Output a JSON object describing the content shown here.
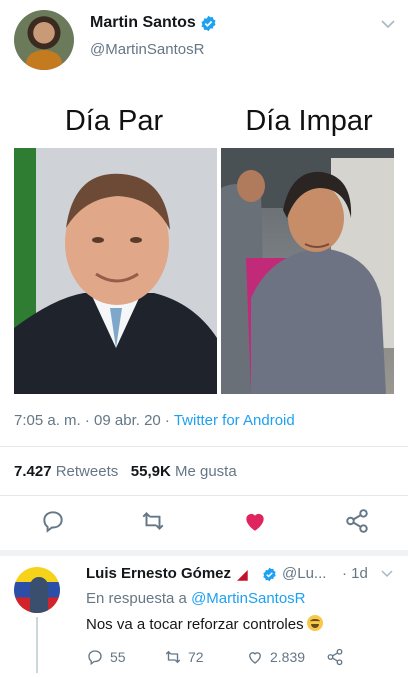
{
  "tweet": {
    "author_name": "Martin Santos",
    "author_handle": "@MartinSantosR",
    "media": {
      "left_label": "Día Par",
      "right_label": "Día Impar"
    },
    "timestamp": "7:05 a. m. · 09 abr. 20 · ",
    "source": "Twitter for Android",
    "retweets_count": "7.427",
    "retweets_label": "Retweets",
    "likes_count": "55,9K",
    "likes_label": "Me gusta"
  },
  "reply": {
    "author_name": "Luis Ernesto Gómez",
    "handle": "@Lu...",
    "time": "· 1d",
    "replying_prefix": "En respuesta a ",
    "replying_to": "@MartinSantosR",
    "text": "Nos va a tocar reforzar controles",
    "replies": "55",
    "retweets": "72",
    "likes": "2.839"
  },
  "colors": {
    "accent": "#1da1f2",
    "like": "#e0245e",
    "muted": "#657786"
  },
  "icons": [
    "verified-badge-icon",
    "chevron-down-icon",
    "reply-icon",
    "retweet-icon",
    "heart-icon",
    "share-icon",
    "laughing-emoji-icon"
  ]
}
